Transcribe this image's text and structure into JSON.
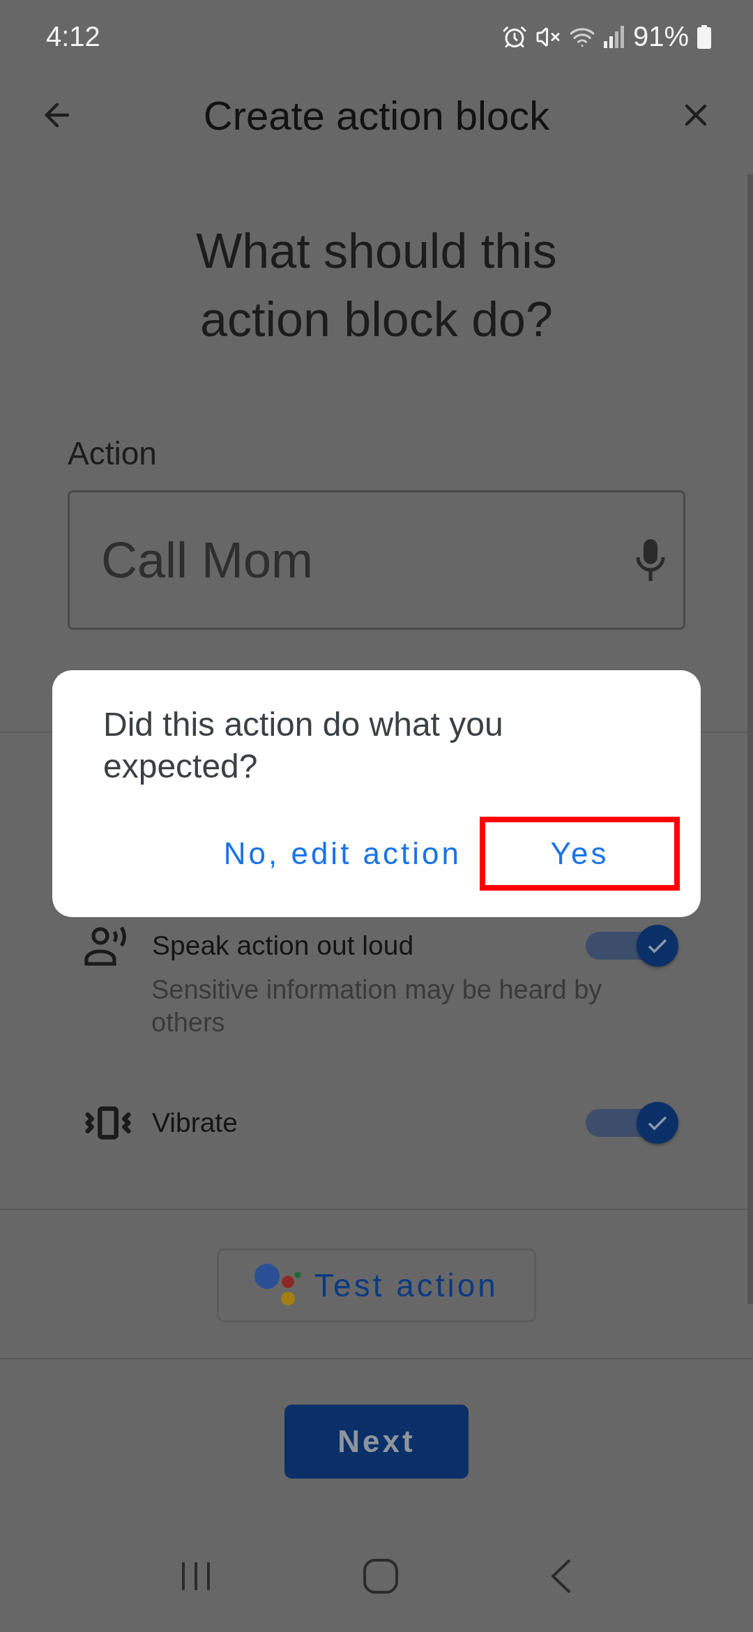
{
  "status_bar": {
    "time": "4:12",
    "battery": "91%"
  },
  "app_bar": {
    "title": "Create action block"
  },
  "heading": "What should this action block do?",
  "action_field": {
    "label": "Action",
    "value": "Call Mom"
  },
  "options": [
    {
      "kind": "speak",
      "label": "Speak action out loud",
      "description": "Sensitive information may be heard by others",
      "on": true
    },
    {
      "kind": "vibrate",
      "label": "Vibrate",
      "on": true
    }
  ],
  "test_button": {
    "label": "Test action"
  },
  "next_button": {
    "label": "Next"
  },
  "dialog": {
    "message": "Did this action do what you expected?",
    "buttons": [
      {
        "label": "No, edit action",
        "highlighted": false
      },
      {
        "label": "Yes",
        "highlighted": true
      }
    ]
  }
}
